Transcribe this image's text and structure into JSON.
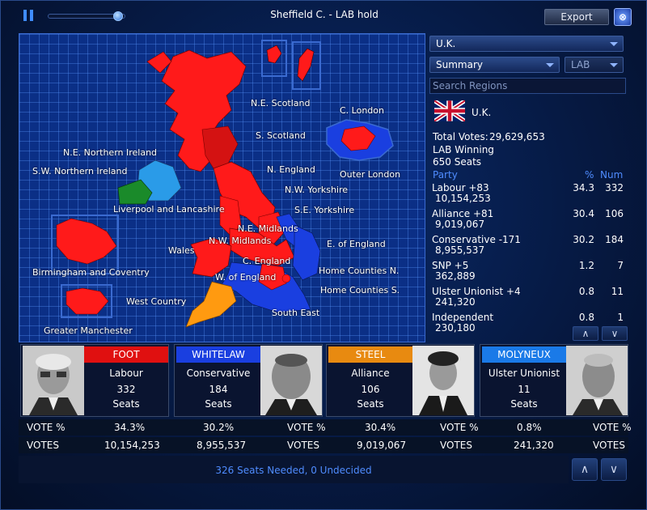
{
  "window": {
    "title": "Sheffield C. - LAB hold",
    "export_label": "Export",
    "close_glyph": "⊗"
  },
  "playback": {
    "pause_icon": "pause-icon",
    "slider_fraction": 0.95
  },
  "map": {
    "regions": [
      {
        "id": "ne-scotland",
        "label": "N.E. Scotland"
      },
      {
        "id": "c-london",
        "label": "C. London"
      },
      {
        "id": "s-scotland",
        "label": "S. Scotland"
      },
      {
        "id": "ne-ni",
        "label": "N.E. Northern Ireland"
      },
      {
        "id": "sw-ni",
        "label": "S.W. Northern Ireland"
      },
      {
        "id": "n-england",
        "label": "N. England"
      },
      {
        "id": "outer-london",
        "label": "Outer London"
      },
      {
        "id": "nw-yorkshire",
        "label": "N.W. Yorkshire"
      },
      {
        "id": "liverpool",
        "label": "Liverpool and Lancashire"
      },
      {
        "id": "s-yorkshire",
        "label": "S.E. Yorkshire"
      },
      {
        "id": "ne-midlands",
        "label": "N.E. Midlands"
      },
      {
        "id": "e-england",
        "label": "E. of England"
      },
      {
        "id": "nw-midlands",
        "label": "N.W. Midlands"
      },
      {
        "id": "wales",
        "label": "Wales"
      },
      {
        "id": "birmingham",
        "label": "Birmingham and Coventry"
      },
      {
        "id": "c-england",
        "label": "C. England"
      },
      {
        "id": "home-counties-n",
        "label": "Home Counties N."
      },
      {
        "id": "w-england",
        "label": "W. of England"
      },
      {
        "id": "home-counties-s",
        "label": "Home Counties S."
      },
      {
        "id": "west-country",
        "label": "West Country"
      },
      {
        "id": "south-east",
        "label": "South East"
      },
      {
        "id": "greater-manchester",
        "label": "Greater Manchester"
      }
    ],
    "colors": {
      "labour": "#ff1a1a",
      "labour_dark": "#cc1010",
      "conservative": "#1a3fe0",
      "alliance": "#ff9a10",
      "ulster": "#2a9be8",
      "ni_other": "#1a8a2a",
      "grid": "#0b2f86"
    }
  },
  "filters": {
    "region_select": "U.K.",
    "view_select": "Summary",
    "party_select": "LAB",
    "search_placeholder": "Search Regions"
  },
  "summary": {
    "flag_icon": "uk-flag-icon",
    "region_name": "U.K.",
    "total_votes_label": "Total Votes:",
    "total_votes_value": "29,629,653",
    "winning": "LAB Winning",
    "seats": "650 Seats",
    "col_party": "Party",
    "col_pct": "%",
    "col_num": "Num",
    "rows": [
      {
        "name": "Labour +83",
        "votes": "10,154,253",
        "pct": "34.3",
        "num": "332"
      },
      {
        "name": "Alliance +81",
        "votes": "9,019,067",
        "pct": "30.4",
        "num": "106"
      },
      {
        "name": "Conservative -171",
        "votes": "8,955,537",
        "pct": "30.2",
        "num": "184"
      },
      {
        "name": "SNP +5",
        "votes": "362,889",
        "pct": "1.2",
        "num": "7"
      },
      {
        "name": "Ulster Unionist +4",
        "votes": "241,320",
        "pct": "0.8",
        "num": "11"
      },
      {
        "name": "Independent",
        "votes": "230,180",
        "pct": "0.8",
        "num": "1"
      }
    ],
    "scroll_up": "∧",
    "scroll_down": "∨"
  },
  "cards": [
    {
      "leader": "FOOT",
      "party": "Labour",
      "seats": "332",
      "seats_label": "Seats",
      "color": "#e01010",
      "vote_label": "VOTE %",
      "vote_pct": "34.3%",
      "votes_label": "VOTES",
      "votes": "10,154,253"
    },
    {
      "leader": "WHITELAW",
      "party": "Conservative",
      "seats": "184",
      "seats_label": "Seats",
      "color": "#1a3fe0",
      "vote_label": "VOTE %",
      "vote_pct": "30.2%",
      "votes_label": "VOTES",
      "votes": "8,955,537"
    },
    {
      "leader": "STEEL",
      "party": "Alliance",
      "seats": "106",
      "seats_label": "Seats",
      "color": "#e88a10",
      "vote_label": "VOTE %",
      "vote_pct": "30.4%",
      "votes_label": "VOTES",
      "votes": "9,019,067"
    },
    {
      "leader": "MOLYNEUX",
      "party": "Ulster Unionist",
      "seats": "11",
      "seats_label": "Seats",
      "color": "#1a7ae8",
      "vote_label": "VOTE %",
      "vote_pct": "0.8%",
      "votes_label": "VOTES",
      "votes": "241,320"
    }
  ],
  "footer": {
    "needed": "326 Seats Needed, 0 Undecided",
    "prev": "∧",
    "next": "∨"
  }
}
